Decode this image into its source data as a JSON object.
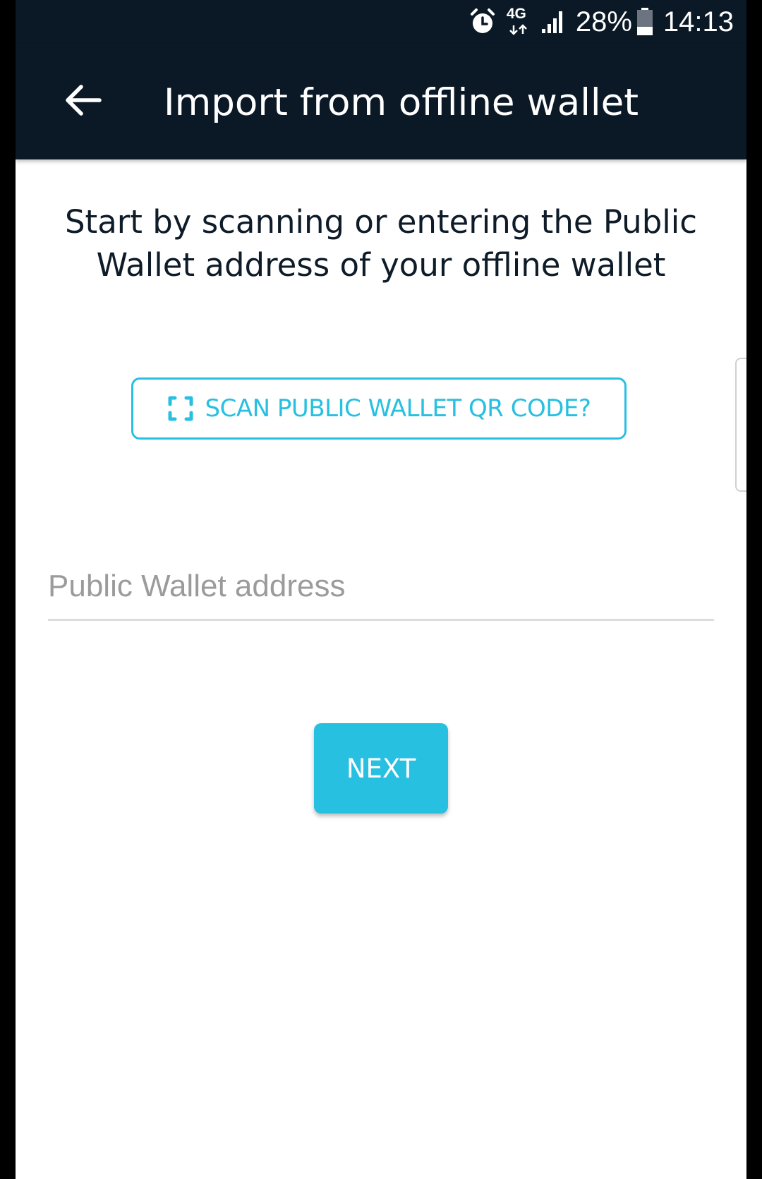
{
  "status_bar": {
    "alarm_icon": "alarm-clock-icon",
    "network_type": "4G",
    "signal_icon": "signal-bars-icon",
    "battery_percent": "28%",
    "battery_icon": "battery-icon",
    "time": "14:13"
  },
  "app_bar": {
    "back_icon": "arrow-left-icon",
    "title": "Import from offline wallet"
  },
  "main": {
    "intro_text": "Start by scanning or entering the Public Wallet address of your offline wallet",
    "scan_button": {
      "icon": "qr-scan-frame-icon",
      "label": "SCAN PUBLIC WALLET QR CODE?"
    },
    "address_field": {
      "value": "",
      "placeholder": "Public Wallet address"
    },
    "next_button_label": "NEXT"
  },
  "colors": {
    "header_bg": "#0b1826",
    "accent": "#27c0e1",
    "text_dark": "#0e1b28",
    "placeholder": "#9b9b9b"
  }
}
